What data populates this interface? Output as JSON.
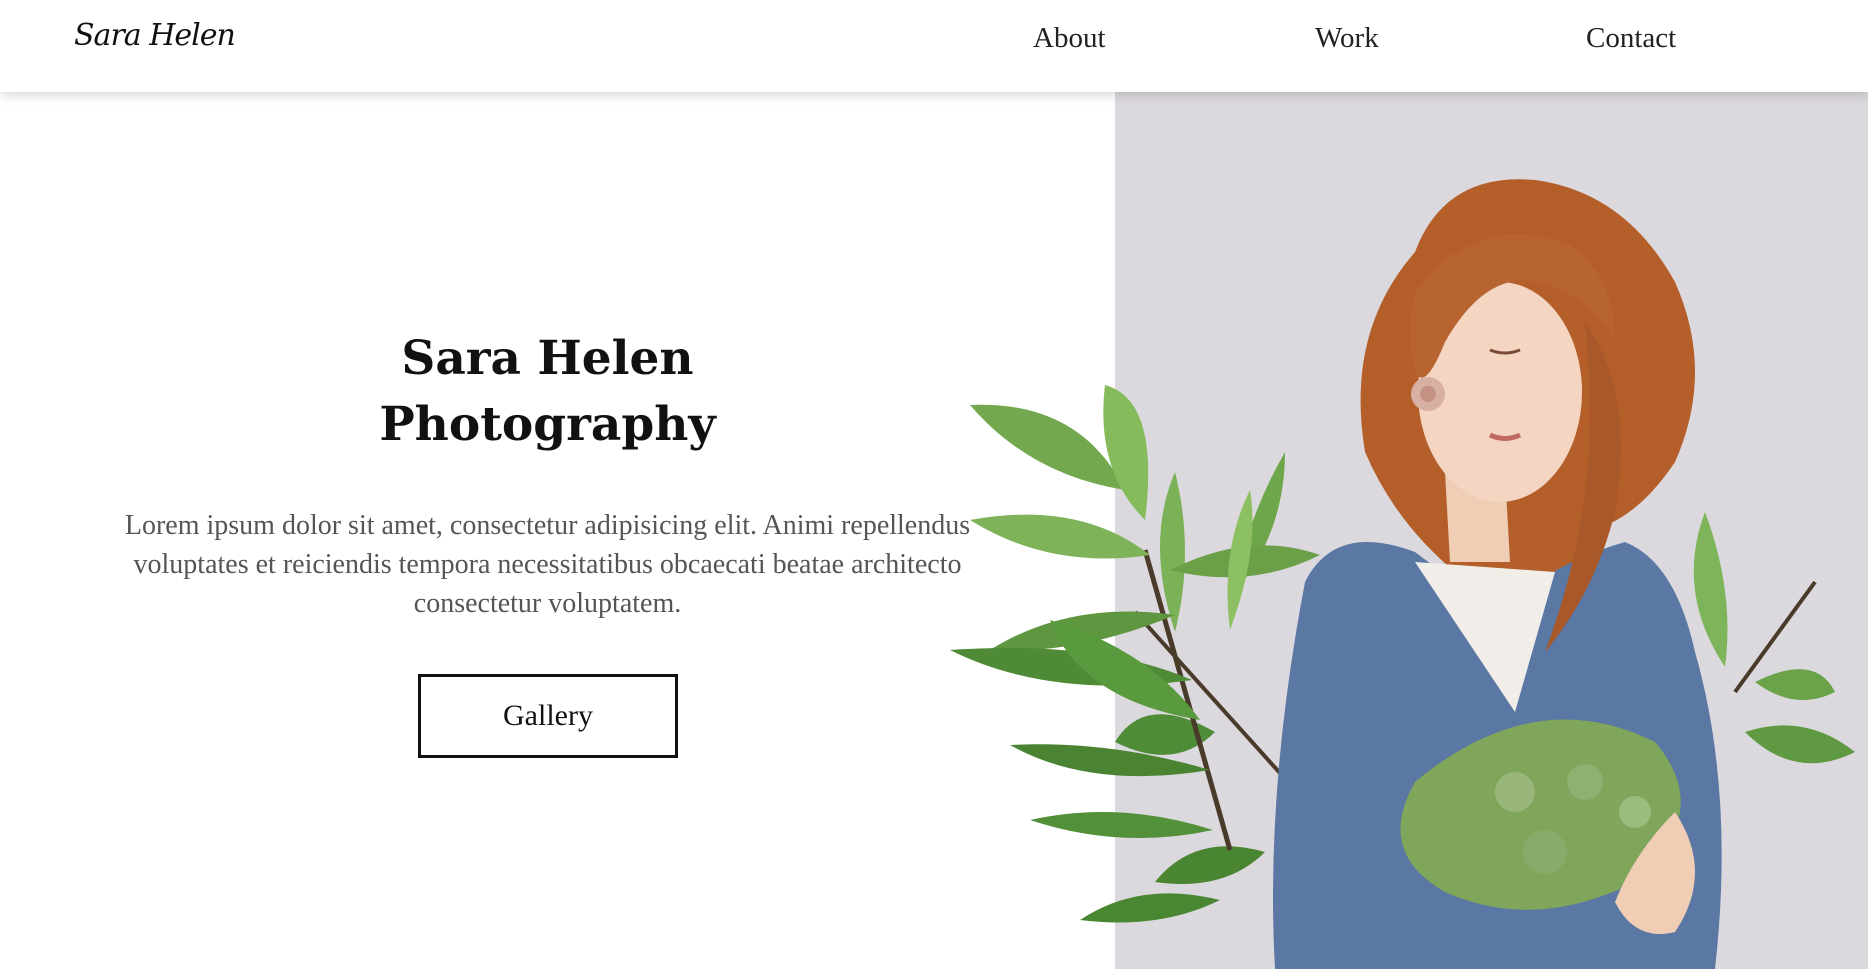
{
  "nav": {
    "logo": "Sara Helen",
    "links": [
      {
        "label": "About"
      },
      {
        "label": "Work"
      },
      {
        "label": "Contact"
      }
    ]
  },
  "hero": {
    "title_line1": "Sara Helen",
    "title_line2": "Photography",
    "description": "Lorem ipsum dolor sit amet, consectetur adipisicing elit. Animi repellendus voluptates et reiciendis tempora necessitatibus obcaecati beatae architecto consectetur voluptatem.",
    "button_label": "Gallery"
  },
  "colors": {
    "background": "#ffffff",
    "image_backdrop": "#dcd9de",
    "text_primary": "#111111",
    "text_muted": "#555555"
  }
}
